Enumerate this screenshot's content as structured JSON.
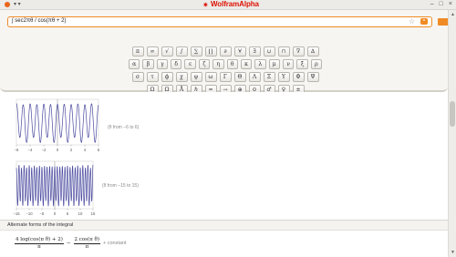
{
  "window": {
    "brand": "WolframAlpha",
    "controls": [
      "–",
      "□",
      "×"
    ]
  },
  "query": {
    "value": "∫ sec2πθ / cos(πθ + 2)"
  },
  "keyboard": {
    "rows": [
      [
        "π",
        "∞",
        "√",
        "∫",
        "∑",
        "∏",
        "∂",
        "∀",
        "∃",
        "∪",
        "∩",
        "∇",
        "∆"
      ],
      [
        "α",
        "β",
        "γ",
        "δ",
        "ε",
        "ζ",
        "η",
        "θ",
        "κ",
        "λ",
        "μ",
        "ν",
        "ξ",
        "ρ"
      ],
      [
        "σ",
        "τ",
        "ϕ",
        "χ",
        "ψ",
        "ω",
        "Γ",
        "Θ",
        "Λ",
        "Ξ",
        "Υ",
        "Φ",
        "Ψ"
      ],
      [
        "Ω",
        "Ω",
        "Å",
        "ℏ",
        "=",
        "→",
        "⊕",
        "⊙",
        "♂",
        "♀",
        "±"
      ]
    ]
  },
  "results": {
    "plot1_caption": "(θ from −6 to 6)",
    "plot1_ticks": [
      "−6",
      "−4",
      "−2",
      "0",
      "2",
      "4",
      "6"
    ],
    "plot2_caption": "(θ from −15 to 15)",
    "plot2_ticks": [
      "−15",
      "−10",
      "−5",
      "0",
      "5",
      "10",
      "15"
    ],
    "pod_title": "Alternate forms of the integral",
    "formula": {
      "term1_num": "4 log(cos(π θ) + 2)",
      "term1_den": "π",
      "op": "−",
      "term2_num": "2 cos(π θ)",
      "term2_den": "π",
      "constant": "+ constant"
    }
  },
  "colors": {
    "accent": "#f08a24",
    "brand": "#dd1100",
    "plot_line": "#4a4aa0"
  }
}
